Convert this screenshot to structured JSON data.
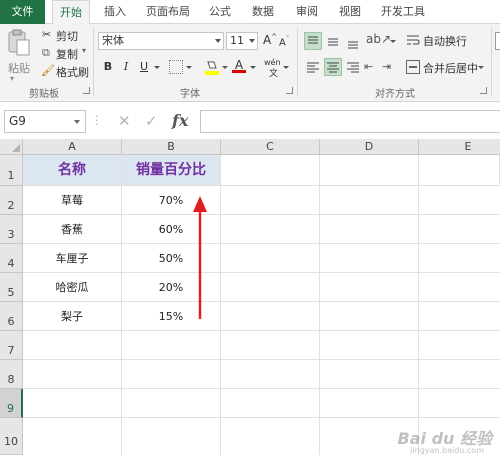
{
  "ribbon_tabs": [
    "文件",
    "开始",
    "插入",
    "页面布局",
    "公式",
    "数据",
    "审阅",
    "视图",
    "开发工具"
  ],
  "clipboard": {
    "paste": "粘贴",
    "cut": "剪切",
    "copy": "复制",
    "painter": "格式刷",
    "group": "剪贴板"
  },
  "font": {
    "name": "宋体",
    "size": "11",
    "bold": "B",
    "italic": "I",
    "underline": "U",
    "grow": "A",
    "shrink": "A",
    "phonetic": "wén",
    "group": "字体"
  },
  "alignment": {
    "wrap": "自动换行",
    "merge": "合并后居中",
    "group": "对齐方式"
  },
  "formula_bar": {
    "name_box": "G9",
    "fx": "fx",
    "cancel": "✕",
    "enter": "✓"
  },
  "columns": [
    "A",
    "B",
    "C",
    "D",
    "E"
  ],
  "rows": [
    "1",
    "2",
    "3",
    "4",
    "5",
    "6",
    "7",
    "8",
    "9",
    "10"
  ],
  "table": {
    "headers": [
      "名称",
      "销量百分比"
    ],
    "data": [
      [
        "草莓",
        "70%"
      ],
      [
        "香蕉",
        "60%"
      ],
      [
        "车厘子",
        "50%"
      ],
      [
        "哈密瓜",
        "20%"
      ],
      [
        "梨子",
        "15%"
      ]
    ]
  },
  "watermark": {
    "main": "Bai du 经验",
    "sub": "jingyan.baidu.com"
  },
  "colors": {
    "accent": "#217346",
    "header_fill": "#dce6f1",
    "header_text": "#7030a0",
    "arrow": "#e02020"
  }
}
